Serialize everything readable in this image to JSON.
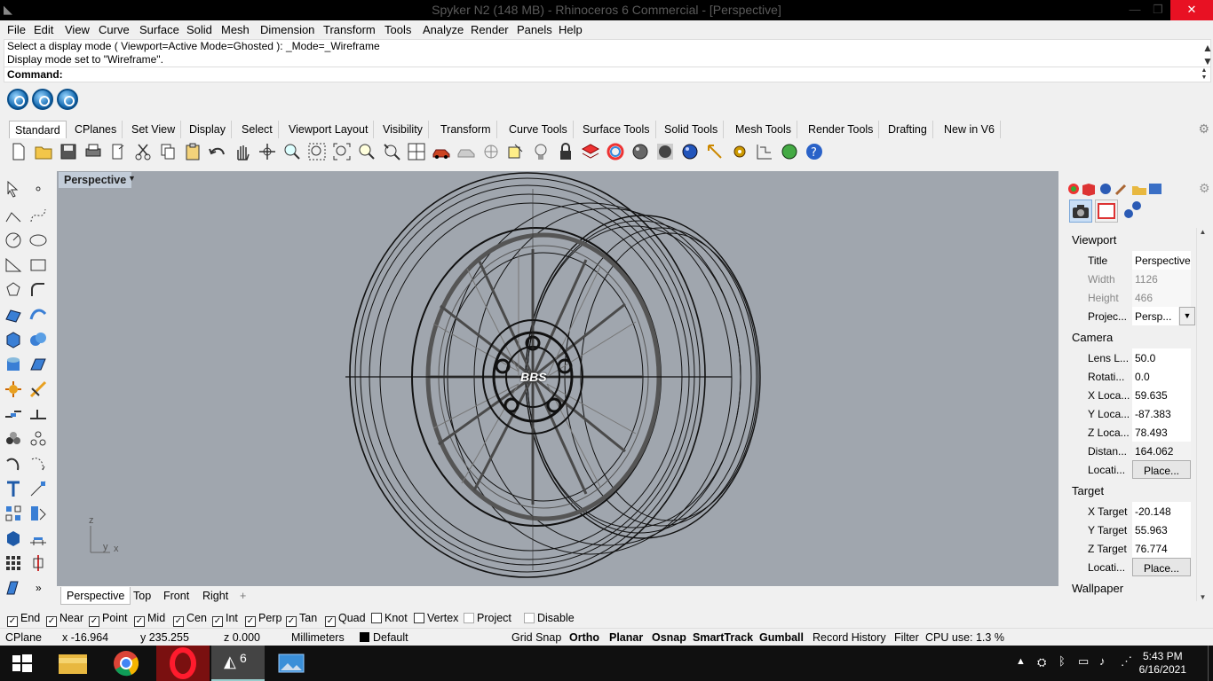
{
  "window": {
    "title": "Spyker N2 (148 MB) - Rhinoceros 6 Commercial - [Perspective]",
    "minimize": "—",
    "maximize": "❐",
    "close": "✕"
  },
  "menu": [
    "File",
    "Edit",
    "View",
    "Curve",
    "Surface",
    "Solid",
    "Mesh",
    "Dimension",
    "Transform",
    "Tools",
    "Analyze",
    "Render",
    "Panels",
    "Help"
  ],
  "command": {
    "history": [
      "Select a display mode ( Viewport=Active  Mode=Ghosted ): _Mode=_Wireframe",
      "Display mode set to \"Wireframe\"."
    ],
    "prompt": "Command:"
  },
  "tabs": [
    "Standard",
    "CPlanes",
    "Set View",
    "Display",
    "Select",
    "Viewport Layout",
    "Visibility",
    "Transform",
    "Curve Tools",
    "Surface Tools",
    "Solid Tools",
    "Mesh Tools",
    "Render Tools",
    "Drafting",
    "New in V6"
  ],
  "viewport": {
    "title": "Perspective",
    "wheel_logo": "BBS",
    "axis_z": "z",
    "axis_y": "y",
    "axis_x": "x"
  },
  "viewport_tabs": [
    "Perspective",
    "Top",
    "Front",
    "Right",
    "+"
  ],
  "properties": {
    "viewport_section": "Viewport",
    "title_label": "Title",
    "title_value": "Perspective",
    "width_label": "Width",
    "width_value": "1126",
    "height_label": "Height",
    "height_value": "466",
    "projection_label": "Projec...",
    "projection_value": "Persp...",
    "camera_section": "Camera",
    "lens_label": "Lens L...",
    "lens_value": "50.0",
    "rotation_label": "Rotati...",
    "rotation_value": "0.0",
    "xloc_label": "X Loca...",
    "xloc_value": "59.635",
    "yloc_label": "Y Loca...",
    "yloc_value": "-87.383",
    "zloc_label": "Z Loca...",
    "zloc_value": "78.493",
    "dist_label": "Distan...",
    "dist_value": "164.062",
    "cam_loc_label": "Locati...",
    "cam_loc_button": "Place...",
    "target_section": "Target",
    "xt_label": "X Target",
    "xt_value": "-20.148",
    "yt_label": "Y Target",
    "yt_value": "55.963",
    "zt_label": "Z Target",
    "zt_value": "76.774",
    "tgt_loc_label": "Locati...",
    "tgt_loc_button": "Place...",
    "wallpaper_section": "Wallpaper"
  },
  "osnaps": [
    {
      "label": "End",
      "checked": true
    },
    {
      "label": "Near",
      "checked": true
    },
    {
      "label": "Point",
      "checked": true
    },
    {
      "label": "Mid",
      "checked": true
    },
    {
      "label": "Cen",
      "checked": true
    },
    {
      "label": "Int",
      "checked": true
    },
    {
      "label": "Perp",
      "checked": true
    },
    {
      "label": "Tan",
      "checked": true
    },
    {
      "label": "Quad",
      "checked": true
    },
    {
      "label": "Knot",
      "checked": false
    },
    {
      "label": "Vertex",
      "checked": false
    },
    {
      "label": "Project",
      "checked": false
    },
    {
      "label": "Disable",
      "checked": false
    }
  ],
  "status": {
    "cplane": "CPlane",
    "x": "x -16.964",
    "y": "y 235.255",
    "z": "z 0.000",
    "units": "Millimeters",
    "layer": "Default",
    "grid_snap": "Grid Snap",
    "ortho": "Ortho",
    "planar": "Planar",
    "osnap": "Osnap",
    "smarttrack": "SmartTrack",
    "gumball": "Gumball",
    "record_history": "Record History",
    "filter": "Filter",
    "cpu": "CPU use: 1.3 %"
  },
  "taskbar": {
    "time": "5:43 PM",
    "date": "6/16/2021",
    "rhino_badge": "6"
  },
  "colors": {
    "viewport_bg": "#a0a6ae",
    "active_tab": "#ffffff",
    "close_red": "#e81123"
  }
}
